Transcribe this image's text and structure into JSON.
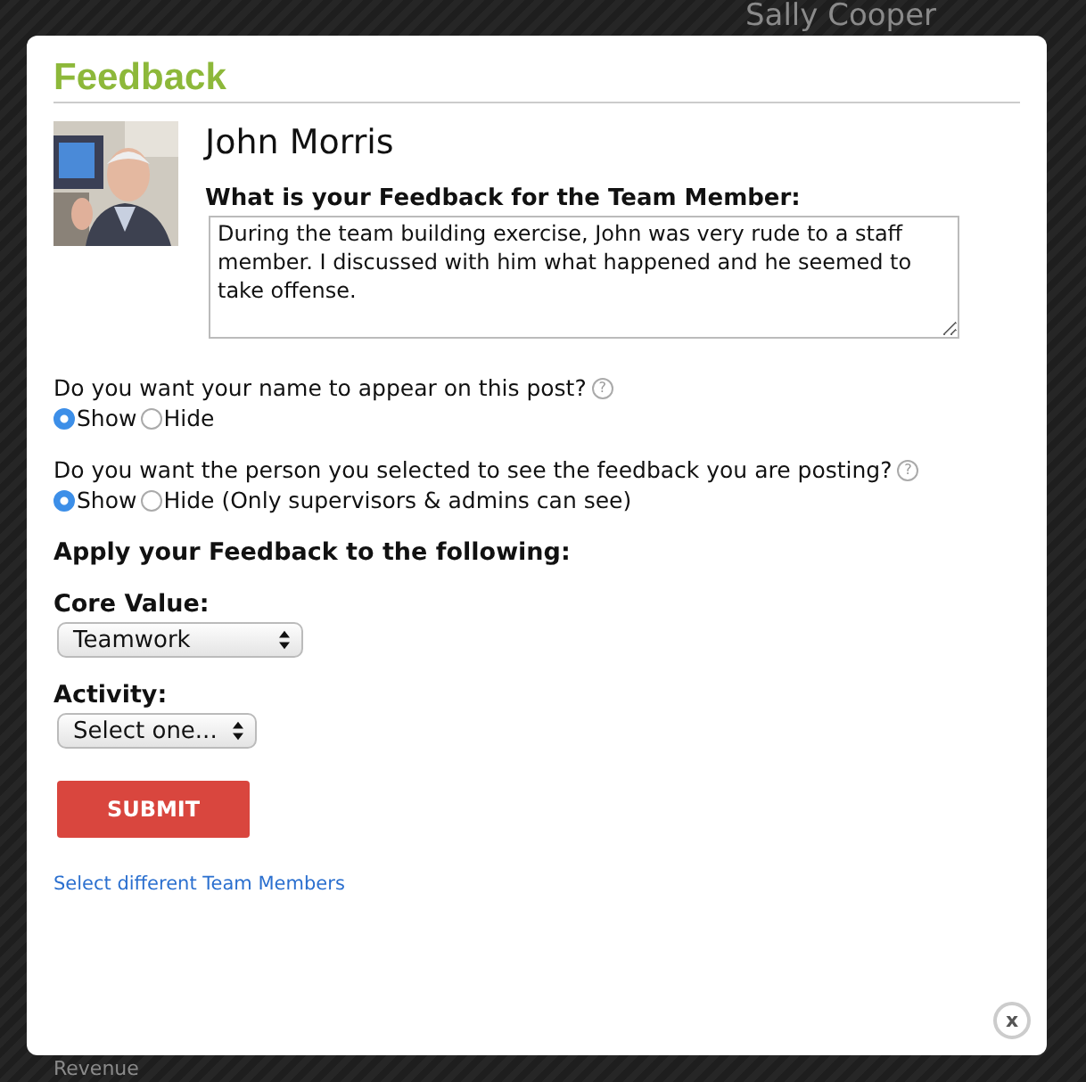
{
  "background": {
    "texts": [
      "Sally Cooper",
      "Revenue"
    ]
  },
  "dialog": {
    "title": "Feedback",
    "member": {
      "name": "John Morris"
    },
    "feedback": {
      "label": "What is your Feedback for the Team Member:",
      "value": "During the team building exercise, John was very rude to a staff member. I discussed with him what happened and he seemed to take offense."
    },
    "questions": [
      {
        "text": "Do you want your name to appear on this post?",
        "help": "?",
        "options": [
          {
            "label": "Show",
            "selected": true
          },
          {
            "label": "Hide",
            "selected": false
          }
        ]
      },
      {
        "text": "Do you want the person you selected to see the feedback you are posting?",
        "help": "?",
        "options": [
          {
            "label": "Show",
            "selected": true
          },
          {
            "label": "Hide (Only supervisors & admins can see)",
            "selected": false
          }
        ]
      }
    ],
    "apply_heading": "Apply your Feedback to the following:",
    "selects": [
      {
        "label": "Core Value:",
        "value": "Teamwork"
      },
      {
        "label": "Activity:",
        "value": "Select one..."
      }
    ],
    "submit": "SUBMIT",
    "link": "Select different Team Members",
    "close": "x"
  }
}
